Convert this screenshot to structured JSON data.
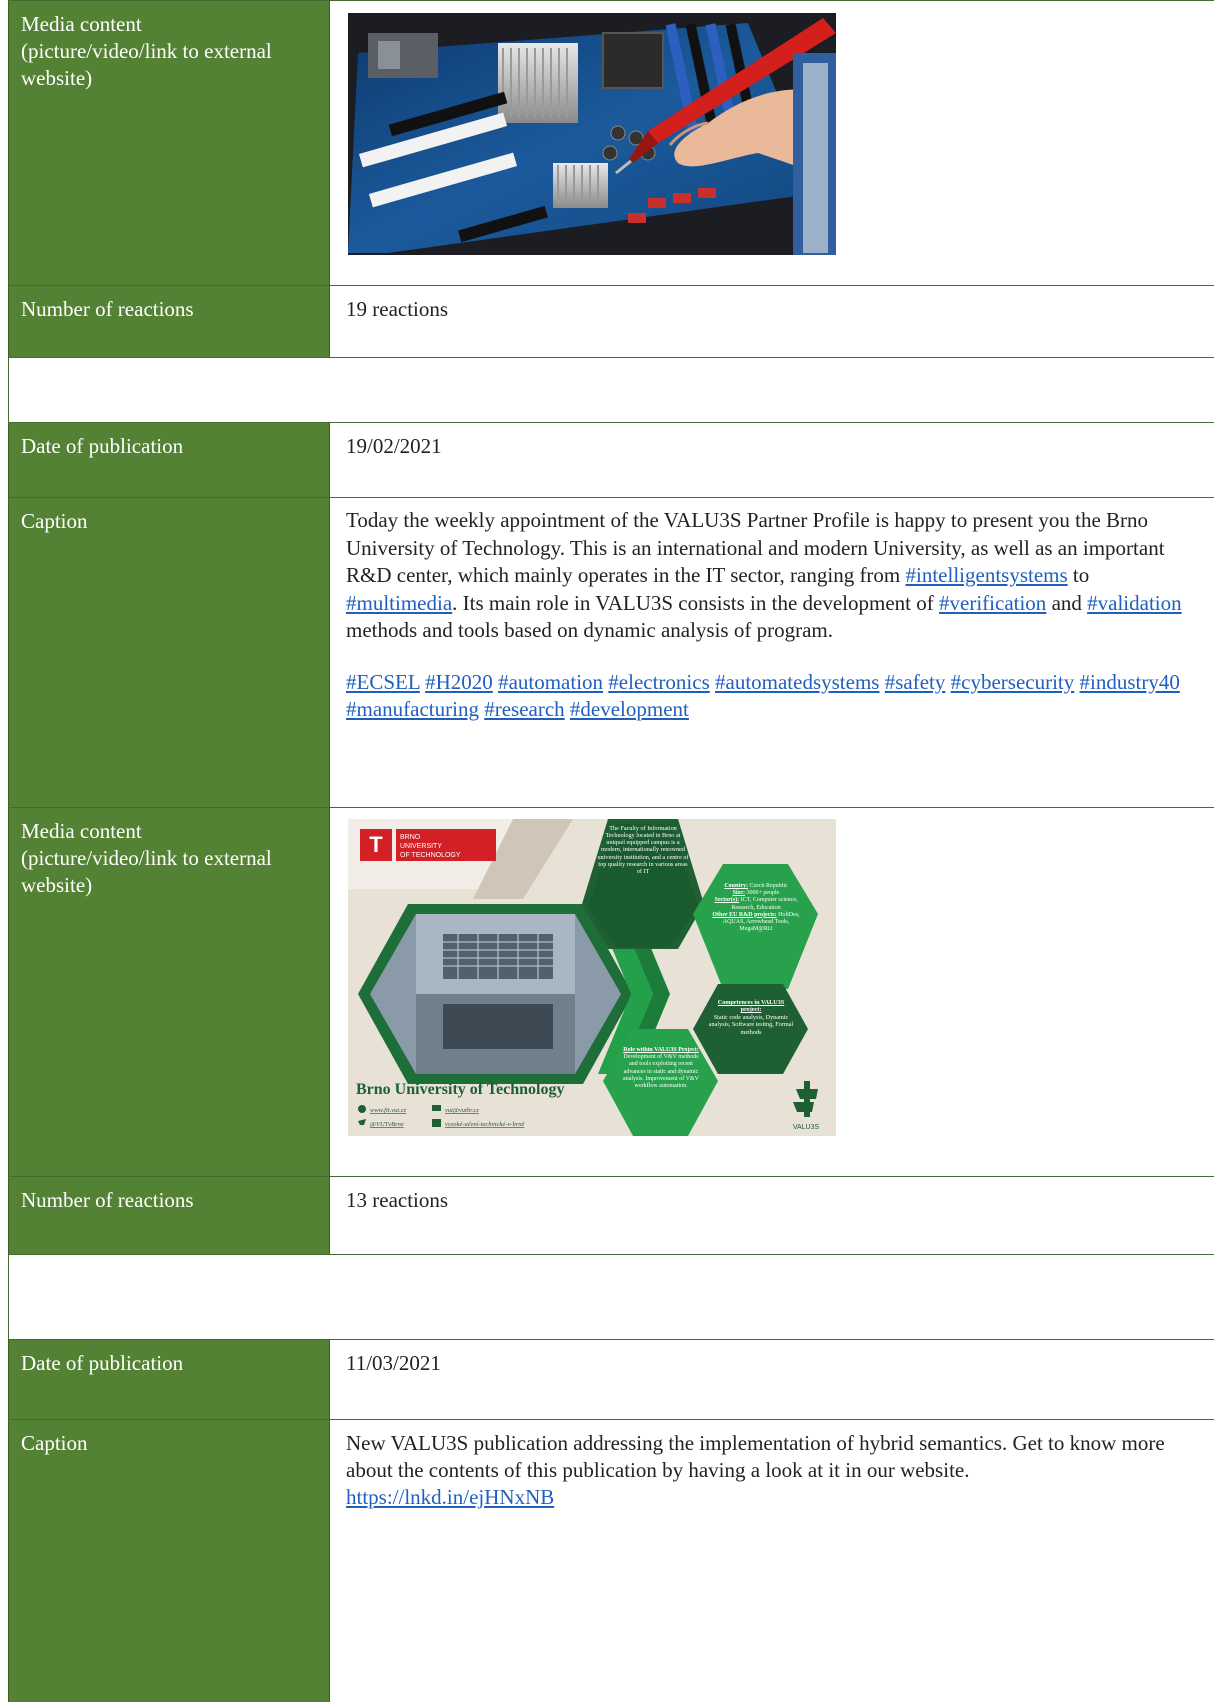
{
  "rows": [
    {
      "label": "Media content\n(picture/video/link to external website)"
    },
    {
      "label": "Number of reactions",
      "value": "19 reactions"
    },
    {
      "label": "Date of publication",
      "value": "19/02/2021"
    },
    {
      "label": "Caption",
      "caption_text": "Today the weekly appointment of the VALU3S Partner Profile is happy to present you the Brno University of Technology. This is an international and modern University, as well as an important R&D center, which mainly operates in the IT sector, ranging from ",
      "tag_intelligent": "#intelligentsystems",
      "text_to": " to ",
      "tag_multimedia": "#multimedia",
      "text_role": ". Its main role in VALU3S consists in the development of ",
      "tag_verification": "#verification",
      "text_and": " and ",
      "tag_validation": "#validation",
      "text_end": " methods and tools based on dynamic analysis of program.",
      "hashtags": [
        "#ECSEL",
        "#H2020",
        "#automation",
        "#electronics",
        "#automatedsystems",
        "#safety",
        "#cybersecurity",
        "#industry40",
        "#manufacturing",
        "#research",
        "#development"
      ]
    },
    {
      "label": "Media content\n(picture/video/link to external website)"
    },
    {
      "label": "Number of reactions",
      "value": "13 reactions"
    },
    {
      "label": "Date of publication",
      "value": "11/03/2021"
    },
    {
      "label": "Caption",
      "caption_text": "New VALU3S publication addressing the implementation of hybrid semantics. Get to know more about the contents of this publication by having a look at it in our website.",
      "link": "https://lnkd.in/ejHNxNB"
    }
  ],
  "infographic": {
    "brand_lines": [
      "BRNO",
      "UNIVERSITY",
      "OF TECHNOLOGY"
    ],
    "hex_faculty": "The Faculty of Information Technology located in Brno at uniquel equipped campus is a modern, internationally renowned university institution, and a centre of top quality research in various areas of IT",
    "country_label": "Country:",
    "country_value": "Czech Republic",
    "size_label": "Size:",
    "size_value": "3000+ people",
    "sectors_label": "Sector(s):",
    "sectors_value": "ICT, Computer science, Research, Education",
    "projects_label": "Other EU R&D projects:",
    "projects_value": "HoliDes, AQUAS, Arrowhead Tools, MegaM@Rt2",
    "comp_label": "Competences in VALU3S project:",
    "comp_value": "Static code analysis, Dynamic analysis, Software testing, Formal methods",
    "role_label": "Role within VALU3S Project:",
    "role_value": "Development of V&V methods and tools exploiting recent advances in static and dynamic analysis. Improvement of V&V workflow automation.",
    "university_name": "Brno University of Technology",
    "web": "www.fit.vut.cz",
    "email": "vut@vutbr.cz",
    "twitter": "@VUTvBrne",
    "linkedin": "vysoké-učení-technické-v-brně",
    "logo_text": "VALU3S"
  }
}
